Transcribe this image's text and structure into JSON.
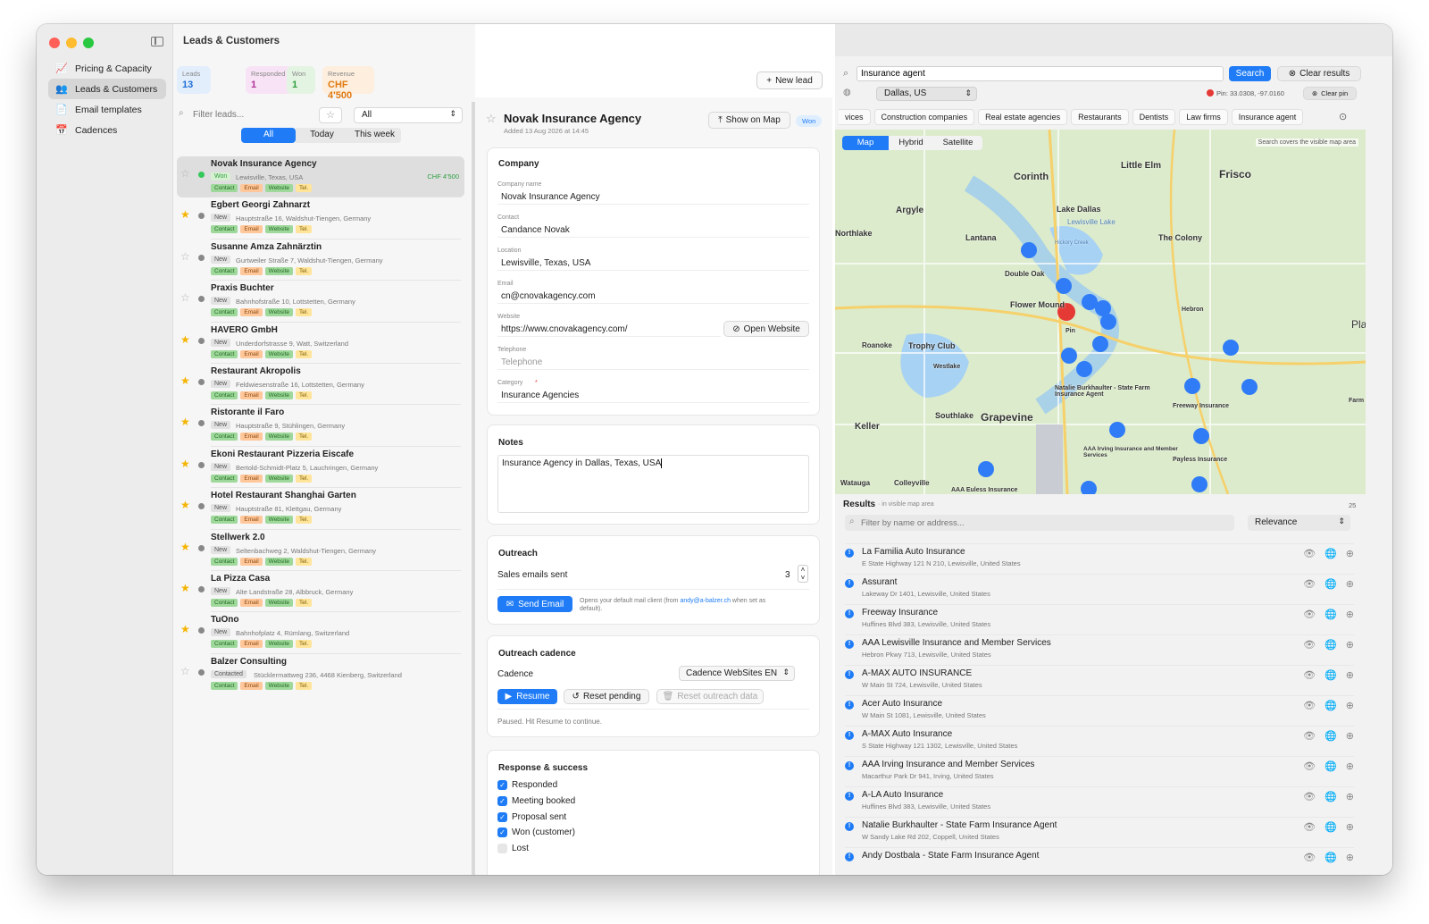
{
  "app": {
    "title": "Leads & Customers"
  },
  "sidebar": {
    "items": [
      {
        "label": "Pricing & Capacity",
        "icon": "chart-icon"
      },
      {
        "label": "Leads & Customers",
        "icon": "people-icon"
      },
      {
        "label": "Email templates",
        "icon": "document-icon"
      },
      {
        "label": "Cadences",
        "icon": "calendar-icon"
      }
    ]
  },
  "stats": [
    {
      "label": "Leads",
      "value": "13",
      "color": "#1f6fd6",
      "bg": "#e3eefc"
    },
    {
      "label": "Responded",
      "value": "1",
      "color": "#b2309a",
      "bg": "#f7e3f5"
    },
    {
      "label": "Won",
      "value": "1",
      "color": "#2e9e3d",
      "bg": "#e4f4e3"
    },
    {
      "label": "Revenue",
      "value": "CHF 4'500",
      "color": "#e07a10",
      "bg": "#fdeedd"
    }
  ],
  "new_lead": "New lead",
  "filter": {
    "placeholder": "Filter leads...",
    "select": "All",
    "tabs": [
      "All",
      "Today",
      "This week"
    ]
  },
  "tag_labels": {
    "contact": "Contact",
    "email": "Email",
    "website": "Website",
    "tel": "Tel."
  },
  "leads": [
    {
      "name": "Novak Insurance Agency",
      "status": "Won",
      "address": "Lewisville, Texas, USA",
      "amount": "CHF 4'500",
      "starred": false,
      "dot": "#34c759"
    },
    {
      "name": "Egbert Georgi Zahnarzt",
      "status": "New",
      "address": "Hauptstraße 16, Waldshut-Tiengen, Germany",
      "starred": true
    },
    {
      "name": "Susanne Amza Zahnärztin",
      "status": "New",
      "address": "Gurtweiler Straße 7, Waldshut-Tiengen, Germany",
      "starred": false
    },
    {
      "name": "Praxis Buchter",
      "status": "New",
      "address": "Bahnhofstraße 10, Lottstetten, Germany",
      "starred": false
    },
    {
      "name": "HAVERO GmbH",
      "status": "New",
      "address": "Underdorfstrasse 9, Watt, Switzerland",
      "starred": true
    },
    {
      "name": "Restaurant Akropolis",
      "status": "New",
      "address": "Feldwiesenstraße 16, Lottstetten, Germany",
      "starred": true
    },
    {
      "name": "Ristorante il Faro",
      "status": "New",
      "address": "Hauptstraße 9, Stühlingen, Germany",
      "starred": true
    },
    {
      "name": "Ekoni Restaurant Pizzeria Eiscafe",
      "status": "New",
      "address": "Bertold-Schmidt-Platz 5, Lauchringen, Germany",
      "starred": true
    },
    {
      "name": "Hotel Restaurant Shanghai Garten",
      "status": "New",
      "address": "Hauptstraße 81, Klettgau, Germany",
      "starred": true
    },
    {
      "name": "Stellwerk 2.0",
      "status": "New",
      "address": "Seltenbachweg 2, Waldshut-Tiengen, Germany",
      "starred": true
    },
    {
      "name": "La Pizza Casa",
      "status": "New",
      "address": "Alte Landstraße 28, Albbruck, Germany",
      "starred": true
    },
    {
      "name": "TuOno",
      "status": "New",
      "address": "Bahnhofplatz 4, Rümlang, Switzerland",
      "starred": true
    },
    {
      "name": "Balzer Consulting",
      "status": "Contacted",
      "address": "Stücklermattweg 236, 4468 Kienberg, Switzerland",
      "starred": false
    }
  ],
  "detail": {
    "name": "Novak Insurance Agency",
    "added": "Added 13 Aug 2026 at 14:45",
    "show_on_map": "Show on Map",
    "badge": "Won",
    "company": {
      "heading": "Company",
      "fields": [
        {
          "label": "Company name",
          "value": "Novak Insurance Agency"
        },
        {
          "label": "Contact",
          "value": "Candance Novak"
        },
        {
          "label": "Location",
          "value": "Lewisville, Texas, USA"
        },
        {
          "label": "Email",
          "value": "cn@cnovakagency.com"
        },
        {
          "label": "Website",
          "value": "https://www.cnovakagency.com/"
        },
        {
          "label": "Telephone",
          "value": "",
          "placeholder": "Telephone"
        },
        {
          "label": "Category",
          "value": "Insurance Agencies"
        }
      ],
      "open_website": "Open Website",
      "required_mark": "*"
    },
    "notes": {
      "heading": "Notes",
      "value": "Insurance Agency in Dallas, Texas, USA"
    },
    "outreach": {
      "heading": "Outreach",
      "sales_label": "Sales emails sent",
      "sales_value": "3",
      "send_email": "Send Email",
      "hint_pre": "Opens your default mail client (from ",
      "hint_email": "andy@a-balzer.ch",
      "hint_post": " when set as default)."
    },
    "cadence": {
      "heading": "Outreach cadence",
      "label": "Cadence",
      "value": "Cadence WebSites EN",
      "resume": "Resume",
      "reset_pending": "Reset pending",
      "reset_data": "Reset outreach data",
      "status": "Paused. Hit Resume to continue."
    },
    "response": {
      "heading": "Response & success",
      "items": [
        {
          "label": "Responded",
          "checked": true
        },
        {
          "label": "Meeting booked",
          "checked": true
        },
        {
          "label": "Proposal sent",
          "checked": true
        },
        {
          "label": "Won (customer)",
          "checked": true
        },
        {
          "label": "Lost",
          "checked": false
        }
      ]
    }
  },
  "map": {
    "query": "Insurance agent",
    "search": "Search",
    "clear_results": "Clear results",
    "location": "Dallas, US",
    "pin": "Pin: 33.0308, -97.0160",
    "clear_pin": "Clear pin",
    "chips": [
      "vices",
      "Construction companies",
      "Real estate agencies",
      "Restaurants",
      "Dentists",
      "Law firms",
      "Insurance agent"
    ],
    "modes": [
      "Map",
      "Hybrid",
      "Satellite"
    ],
    "covers": "Search covers the visible map area",
    "places": [
      "Corinth",
      "Little Elm",
      "Frisco",
      "Argyle",
      "Lake Dallas",
      "Lewisville Lake",
      "Northlake",
      "Lantana",
      "The Colony",
      "Double Oak",
      "Hickory Creek",
      "Flower Mound",
      "Hebron",
      "Pin",
      "Roanoke",
      "Trophy Club",
      "Westlake",
      "Natalie Burkhaulter - State Farm Insurance Agent",
      "Freeway Insurance",
      "Southlake",
      "Grapevine",
      "Keller",
      "AAA Irving Insurance and Member Services",
      "Payless Insurance",
      "Colleyville",
      "AAA Euless Insurance",
      "Watauga",
      "Farm",
      "Pla"
    ]
  },
  "results": {
    "heading": "Results",
    "sub": "· in visible map area",
    "count": "25",
    "filter_placeholder": "Filter by name or address...",
    "sort": "Relevance",
    "items": [
      {
        "name": "La Familia Auto Insurance",
        "address": "E State Highway 121 N 210, Lewisville, United States"
      },
      {
        "name": "Assurant",
        "address": "Lakeway Dr 1401, Lewisville, United States"
      },
      {
        "name": "Freeway Insurance",
        "address": "Huffines Blvd 383, Lewisville, United States"
      },
      {
        "name": "AAA Lewisville Insurance and Member Services",
        "address": "Hebron Pkwy 713, Lewisville, United States"
      },
      {
        "name": "A-MAX AUTO INSURANCE",
        "address": "W Main St 724, Lewisville, United States"
      },
      {
        "name": "Acer Auto Insurance",
        "address": "W Main St 1081, Lewisville, United States"
      },
      {
        "name": "A-MAX Auto Insurance",
        "address": "S State Highway 121 1302, Lewisville, United States"
      },
      {
        "name": "AAA Irving Insurance and Member Services",
        "address": "Macarthur Park Dr 941, Irving, United States"
      },
      {
        "name": "A-LA Auto Insurance",
        "address": "Huffines Blvd 383, Lewisville, United States"
      },
      {
        "name": "Natalie Burkhaulter - State Farm Insurance Agent",
        "address": "W Sandy Lake Rd 202, Coppell, United States"
      },
      {
        "name": "Andy Dostbala - State Farm Insurance Agent",
        "address": ""
      }
    ]
  }
}
